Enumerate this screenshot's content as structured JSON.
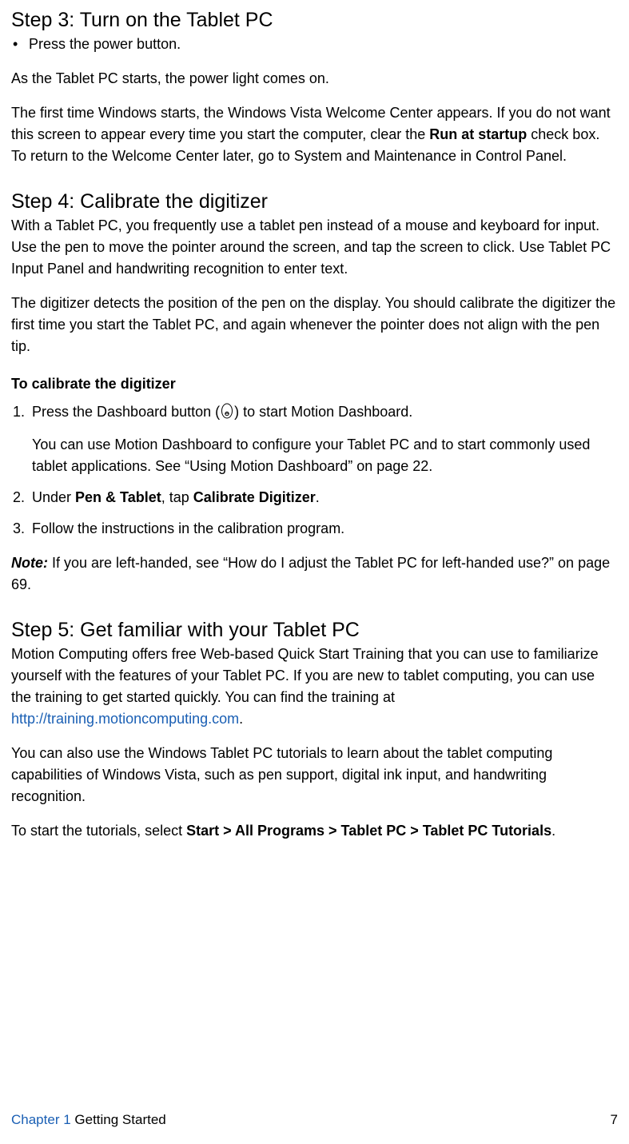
{
  "step3": {
    "heading": "Step 3: Turn on the Tablet PC",
    "bullet1": "Press the power button.",
    "p1": "As the Tablet PC starts, the power light comes on.",
    "p2a": "The first time Windows starts, the Windows Vista Welcome Center appears. If you do not want this screen to appear every time you start the computer, clear the ",
    "p2b": "Run at startup",
    "p2c": " check box. To return to the Welcome Center later, go to System and Maintenance in Control Panel."
  },
  "step4": {
    "heading": "Step 4: Calibrate the digitizer",
    "p1": "With a Tablet PC, you frequently use a tablet pen instead of a mouse and keyboard for input. Use the pen to move the pointer around the screen, and tap the screen to click. Use Tablet PC Input Panel and handwriting recognition to enter text.",
    "p2": "The digitizer detects the position of the pen on the display. You should calibrate the digitizer the first time you start the Tablet PC, and again whenever the pointer does not align with the pen tip.",
    "subhead": "To calibrate the digitizer",
    "li1a": "Press the Dashboard button (",
    "li1b": ") to start Motion Dashboard.",
    "li1p": "You can use Motion Dashboard to configure your Tablet PC and to start commonly used tablet applications. See “Using Motion Dashboard” on page 22.",
    "li2a": "Under ",
    "li2b": "Pen & Tablet",
    "li2c": ", tap ",
    "li2d": "Calibrate Digitizer",
    "li2e": ".",
    "li3": "Follow the instructions in the calibration program.",
    "note_label": "Note:",
    "note_text": " If you are left-handed, see “How do I adjust the Tablet PC for left-handed use?” on page 69."
  },
  "step5": {
    "heading": "Step 5: Get familiar with your Tablet PC",
    "p1a": "Motion Computing offers free Web-based Quick Start Training that you can use to familiarize yourself with the features of your Tablet PC. If you are new to tablet computing, you can use the training to get started quickly. You can find the training at ",
    "p1link": "http://training.motioncomputing.com",
    "p1b": ".",
    "p2": "You can also use the Windows Tablet PC tutorials to learn about the tablet computing capabilities of Windows Vista, such as pen support, digital ink input, and handwriting recognition.",
    "p3a": "To start the tutorials, select ",
    "p3b": "Start",
    "p3gt": " > ",
    "p3c": "All Programs",
    "p3d": "Tablet PC",
    "p3e": "Tablet PC Tutorials",
    "p3f": "."
  },
  "footer": {
    "chapter": "Chapter 1",
    "title": "  Getting Started",
    "page": "7"
  }
}
